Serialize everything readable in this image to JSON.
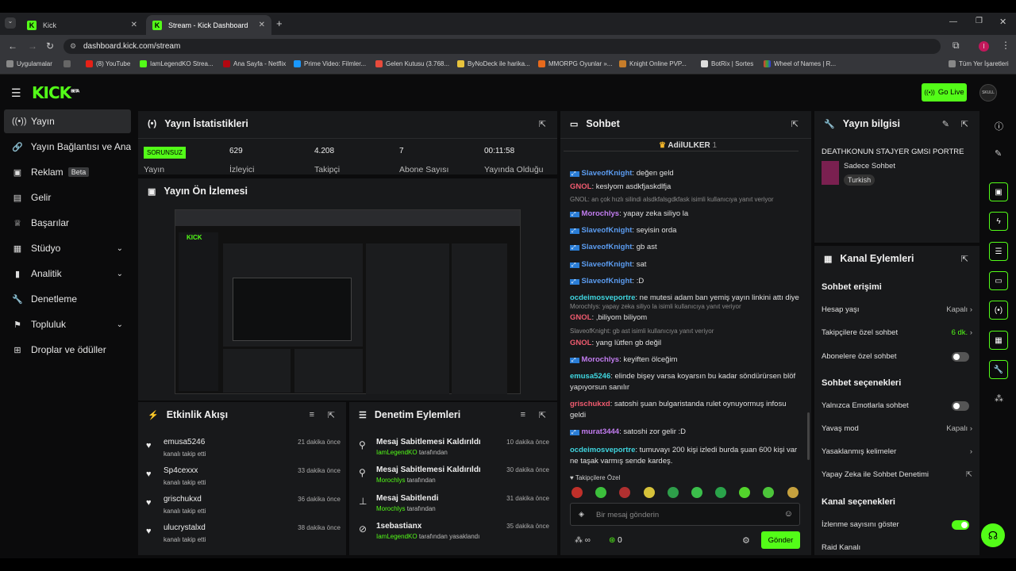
{
  "browser": {
    "tabs": [
      {
        "label": "Kick"
      },
      {
        "label": "Stream - Kick Dashboard"
      }
    ],
    "url": "dashboard.kick.com/stream",
    "bookmarks": [
      "Uygulamalar",
      "(8) YouTube",
      "IamLegendKO Strea...",
      "Ana Sayfa - Netflix",
      "Prime Video: Filmler...",
      "Gelen Kutusu (3.768...",
      "ByNoDeck ile harika...",
      "MMORPG Oyunlar »...",
      "Knight Online PVP...",
      "BotRix | Sortes",
      "Wheel of Names | R..."
    ],
    "all_bookmarks": "Tüm Yer İşaretleri"
  },
  "header": {
    "logo": "KICK",
    "logo_sup": "BETA",
    "go_live": "Go Live"
  },
  "sidebar": {
    "items": [
      {
        "label": "Yayın",
        "icon": "broadcast-icon"
      },
      {
        "label": "Yayın Bağlantısı ve Anahtarı",
        "icon": "link-icon"
      },
      {
        "label": "Reklam",
        "badge": "Beta",
        "icon": "ad-icon"
      },
      {
        "label": "Gelir",
        "icon": "dollar-icon"
      },
      {
        "label": "Başarılar",
        "icon": "trophy-icon"
      },
      {
        "label": "Stüdyo",
        "icon": "studio-icon"
      },
      {
        "label": "Analitik",
        "icon": "chart-icon"
      },
      {
        "label": "Denetleme",
        "icon": "wrench-icon"
      },
      {
        "label": "Topluluk",
        "icon": "community-icon"
      },
      {
        "label": "Droplar ve ödüller",
        "icon": "gift-icon"
      }
    ]
  },
  "stats": {
    "title": "Yayın İstatistikleri",
    "status": "SORUNSUZ",
    "status_label": "Yayın",
    "viewers": "629",
    "viewers_label": "İzleyici",
    "followers": "4.208",
    "followers_label": "Takipçi",
    "subs": "7",
    "subs_label": "Abone Sayısı",
    "uptime": "00:11:58",
    "uptime_label": "Yayında Olduğu"
  },
  "preview": {
    "title": "Yayın Ön İzlemesi"
  },
  "activity": {
    "title": "Etkinlik Akışı",
    "items": [
      {
        "name": "emusa5246",
        "sub": "kanalı takip etti",
        "time": "21 dakika önce"
      },
      {
        "name": "Sp4cexxx",
        "sub": "kanalı takip etti",
        "time": "33 dakika önce"
      },
      {
        "name": "grischukxd",
        "sub": "kanalı takip etti",
        "time": "36 dakika önce"
      },
      {
        "name": "ulucrystalxd",
        "sub": "kanalı takip etti",
        "time": "38 dakika önce"
      }
    ]
  },
  "moderation": {
    "title": "Denetim Eylemleri",
    "items": [
      {
        "action": "Mesaj Sabitlemesi Kaldırıldı",
        "by": "IamLegendKO",
        "suffix": "tarafından",
        "time": "10 dakika önce"
      },
      {
        "action": "Mesaj Sabitlemesi Kaldırıldı",
        "by": "Morochlys",
        "suffix": "tarafından",
        "time": "30 dakika önce"
      },
      {
        "action": "Mesaj Sabitlendi",
        "by": "Morochlys",
        "suffix": "tarafından",
        "time": "31 dakika önce"
      },
      {
        "action": "1sebastianx",
        "by": "IamLegendKO",
        "suffix": "tarafından yasaklandı",
        "time": "35 dakika önce"
      }
    ]
  },
  "chat": {
    "title": "Sohbet",
    "pinned_user": "AdilULKER",
    "pinned_count": "1",
    "messages": [
      {
        "user": "SlaveofKnight",
        "text": "değen geld",
        "color": "#5b9cf0"
      },
      {
        "user": "GNOL",
        "text": "keslyom asdkfjaskdlfja",
        "color": "#f05b6f"
      },
      {
        "reply": "GNOL: an çok hızlı silindi alsdkfalsgdkfask isimli kullanıcıya yanıt veriyor"
      },
      {
        "user": "Morochlys",
        "text": "yapay zeka siliyo la",
        "color": "#c27cf0"
      },
      {
        "user": "SlaveofKnight",
        "text": "seyisin orda",
        "color": "#5b9cf0"
      },
      {
        "user": "SlaveofKnight",
        "text": "gb ast",
        "color": "#5b9cf0"
      },
      {
        "user": "SlaveofKnight",
        "text": "sat",
        "color": "#5b9cf0"
      },
      {
        "user": "SlaveofKnight",
        "text": ":D",
        "color": "#5b9cf0"
      },
      {
        "user": "ocdeimosveportre",
        "text": "ne mutesi adam ban yemiş yayın linkini attı diye",
        "color": "#3fd6e0"
      },
      {
        "reply": "Morochlys: yapay zeka siliyo la isimli kullanıcıya yanıt veriyor"
      },
      {
        "user": "GNOL",
        "text": ",biliyom biliyom",
        "color": "#f05b6f"
      },
      {
        "reply": "SlaveofKnight: gb ast isimli kullanıcıya yanıt veriyor"
      },
      {
        "user": "GNOL",
        "text": "yang lütfen gb değil",
        "color": "#f05b6f"
      },
      {
        "user": "Morochlys",
        "text": "keyiften ölceğim",
        "color": "#c27cf0"
      },
      {
        "user": "emusa5246",
        "text": "elinde bişey varsa koyarsın bu kadar söndürürsen blöf yapıyorsun sanılır",
        "color": "#3fd6e0"
      },
      {
        "user": "grischukxd",
        "text": "satoshi şuan bulgaristanda rulet oynuyormuş infosu geldi",
        "color": "#f05b6f"
      },
      {
        "user": "murat3444",
        "text": "satoshi zor gelir :D",
        "color": "#c27cf0"
      },
      {
        "user": "ocdeimosveportre",
        "text": "tumuvayı 200 kişi izledi burda şuan 600 kişi var ne taşak varmış sende kardeş.",
        "color": "#3fd6e0"
      }
    ],
    "followers_only": "Takipçilere Özel",
    "placeholder": "Bir mesaj gönderin",
    "count": "0",
    "send": "Gönder"
  },
  "info": {
    "title": "Yayın bilgisi",
    "stream_title": "DEATHKONUN STAJYER GMSI PORTRE",
    "category": "Sadece Sohbet",
    "language": "Turkish"
  },
  "channel": {
    "title": "Kanal Eylemleri",
    "sec1": "Sohbet erişimi",
    "acc_age": "Hesap yaşı",
    "acc_age_v": "Kapalı",
    "fol_chat": "Takipçilere özel sohbet",
    "fol_chat_v": "6 dk.",
    "sub_chat": "Abonelere özel sohbet",
    "sec2": "Sohbet seçenekleri",
    "emote": "Yalnızca Emotlarla sohbet",
    "slow": "Yavaş mod",
    "slow_v": "Kapalı",
    "banned": "Yasaklanmış kelimeler",
    "ai": "Yapay Zeka ile Sohbet Denetimi",
    "sec3": "Kanal seçenekleri",
    "view_count": "İzlenme sayısını göster",
    "raid": "Raid Kanalı"
  }
}
